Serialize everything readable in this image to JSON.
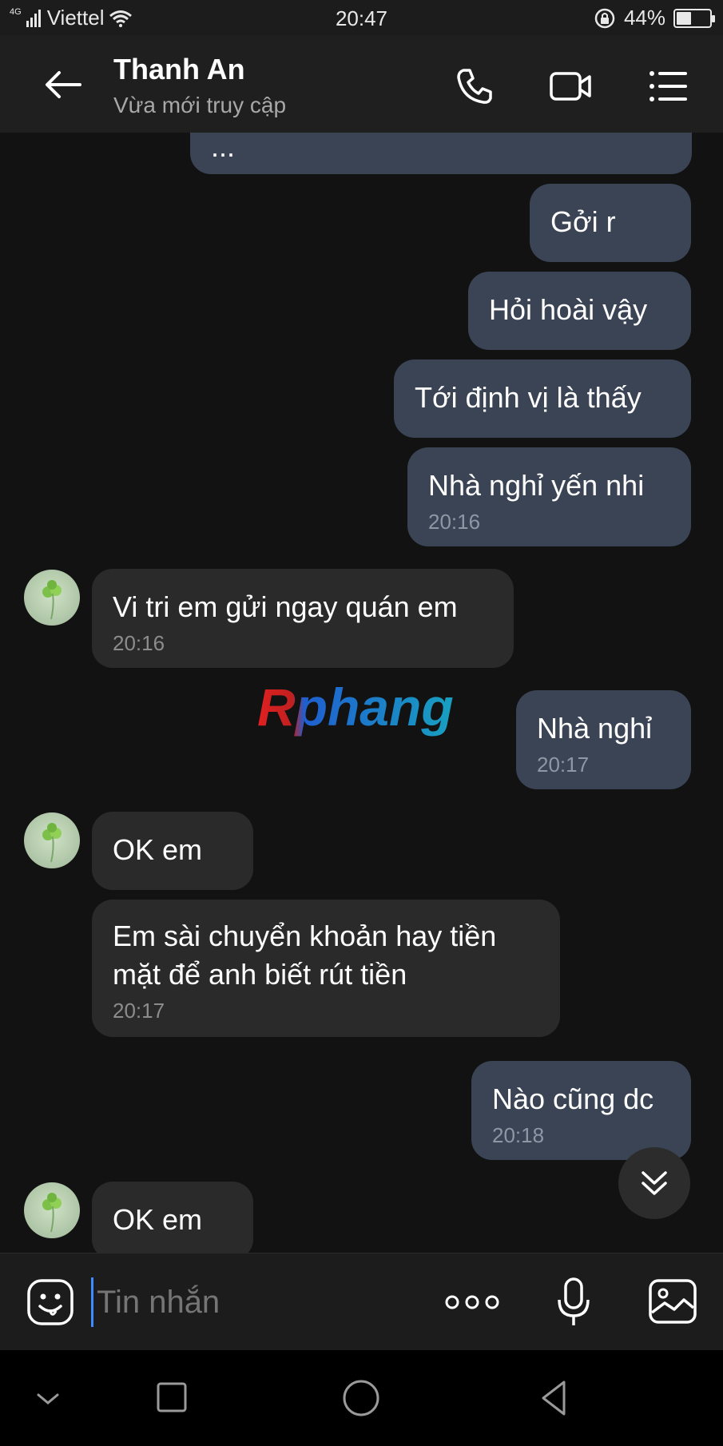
{
  "status_bar": {
    "network": "4G",
    "carrier": "Viettel",
    "time": "20:47",
    "battery": "44%",
    "battery_level": 0.44
  },
  "header": {
    "contact_name": "Thanh An",
    "presence": "Vừa mới truy cập",
    "icons": [
      "back-arrow-icon",
      "phone-icon",
      "video-call-icon",
      "menu-list-icon"
    ]
  },
  "messages": [
    {
      "side": "out",
      "text": "...",
      "time": ""
    },
    {
      "side": "out",
      "text": "Gởi r",
      "time": ""
    },
    {
      "side": "out",
      "text": "Hỏi hoài vậy",
      "time": ""
    },
    {
      "side": "out",
      "text": "Tới định vị là thấy",
      "time": ""
    },
    {
      "side": "out",
      "text": "Nhà nghỉ yến nhi",
      "time": "20:16"
    },
    {
      "side": "in",
      "text": "Vi tri em gửi ngay quán em",
      "time": "20:16"
    },
    {
      "side": "out",
      "text": "Nhà nghỉ",
      "time": "20:17"
    },
    {
      "side": "in",
      "text": "OK em",
      "time": ""
    },
    {
      "side": "in",
      "text": "Em sài chuyển khoản hay tiền mặt để anh biết rút tiền",
      "time": "20:17"
    },
    {
      "side": "out",
      "text": "Nào cũng dc",
      "time": "20:18"
    },
    {
      "side": "in",
      "text": "OK em",
      "time": ""
    }
  ],
  "watermark": {
    "text": "Rphang",
    "colors": [
      "#e02020",
      "#1f5fd0",
      "#18a0c0"
    ]
  },
  "composer": {
    "placeholder": "Tin nhắn",
    "icons": [
      "emoji-icon",
      "more-dots-icon",
      "microphone-icon",
      "image-icon"
    ]
  },
  "nav_bar": {
    "icons": [
      "collapse-chevron-icon",
      "recents-square-icon",
      "home-circle-icon",
      "back-triangle-icon"
    ]
  },
  "colors": {
    "background": "#121212",
    "outgoing_bubble": "#3a4454",
    "incoming_bubble": "#2a2a2a",
    "accent": "#3d8bff"
  }
}
